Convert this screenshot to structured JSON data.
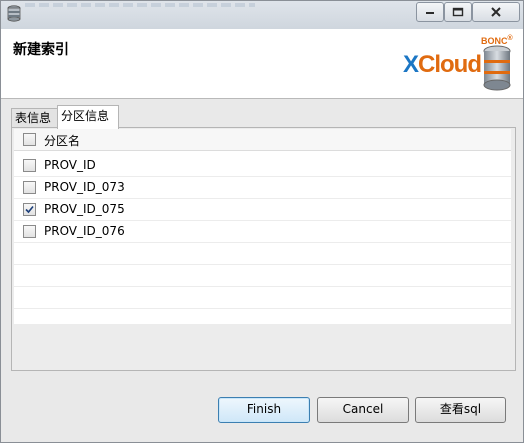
{
  "dialog": {
    "title": "新建索引"
  },
  "logo": {
    "brand_top": "BONC",
    "registered": "®",
    "brand_x": "X",
    "brand_cloud": "Cloud"
  },
  "tabs": [
    {
      "label": "表信息",
      "active": false
    },
    {
      "label": "分区信息",
      "active": true
    }
  ],
  "table": {
    "header": "分区名",
    "rows": [
      {
        "name": "PROV_ID",
        "checked": false
      },
      {
        "name": "PROV_ID_073",
        "checked": false
      },
      {
        "name": "PROV_ID_075",
        "checked": true
      },
      {
        "name": "PROV_ID_076",
        "checked": false
      }
    ]
  },
  "buttons": {
    "finish": "Finish",
    "cancel": "Cancel",
    "sql": "查看sql"
  },
  "colors": {
    "accent_blue": "#1b76c4",
    "accent_orange": "#e06b10"
  }
}
